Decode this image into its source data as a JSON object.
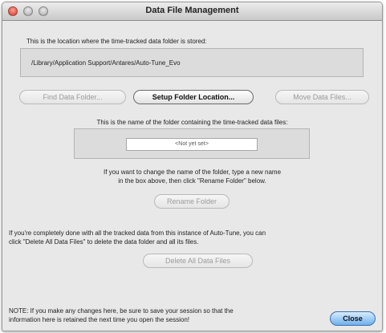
{
  "window": {
    "title": "Data File Management",
    "controls": {
      "close": "close-icon",
      "minimize": "minimize-icon",
      "zoom": "zoom-icon"
    }
  },
  "location": {
    "label": "This is the location where the time-tracked data folder is stored:",
    "path": "/Library/Application Support/Antares/Auto-Tune_Evo"
  },
  "buttons": {
    "find_data_folder": "Find Data Folder...",
    "setup_folder_location": "Setup Folder Location...",
    "move_data_files": "Move Data Files...",
    "rename_folder": "Rename Folder",
    "delete_all_data_files": "Delete All Data Files",
    "close": "Close"
  },
  "folder_name": {
    "label": "This is the name of the folder containing the time-tracked data files:",
    "value": "<Not yet set>",
    "help_line1": "If you want to change the name of the folder, type a new name",
    "help_line2": "in the box above, then click \"Rename Folder\" below."
  },
  "delete_info": {
    "line1": "If you're completely done with all the tracked data from this instance of Auto-Tune, you can",
    "line2": "click \"Delete All Data Files\" to delete the data folder and all its files."
  },
  "note": {
    "line1": "NOTE: If you make any changes here, be sure to save your session so that the",
    "line2": "information here is retained the next time you open the session!"
  }
}
